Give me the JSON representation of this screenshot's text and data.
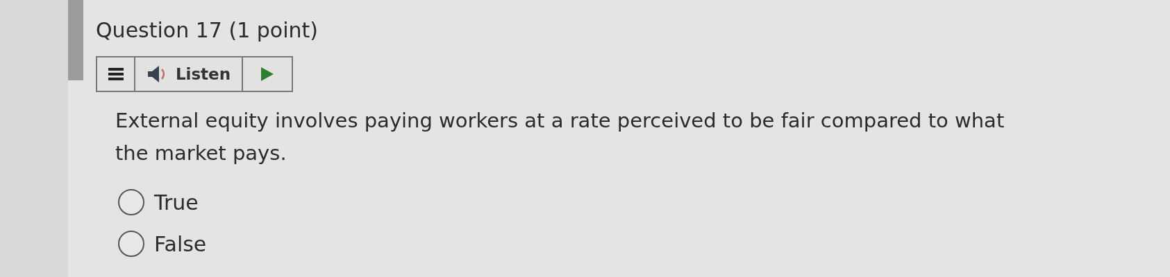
{
  "question": {
    "title": "Question 17",
    "points": "(1 point)"
  },
  "toolbar": {
    "listen_label": "Listen"
  },
  "prompt": "External equity involves paying workers at a rate perceived to be fair compared to what the market pays.",
  "options": [
    {
      "label": "True",
      "selected": false
    },
    {
      "label": "False",
      "selected": false
    }
  ]
}
